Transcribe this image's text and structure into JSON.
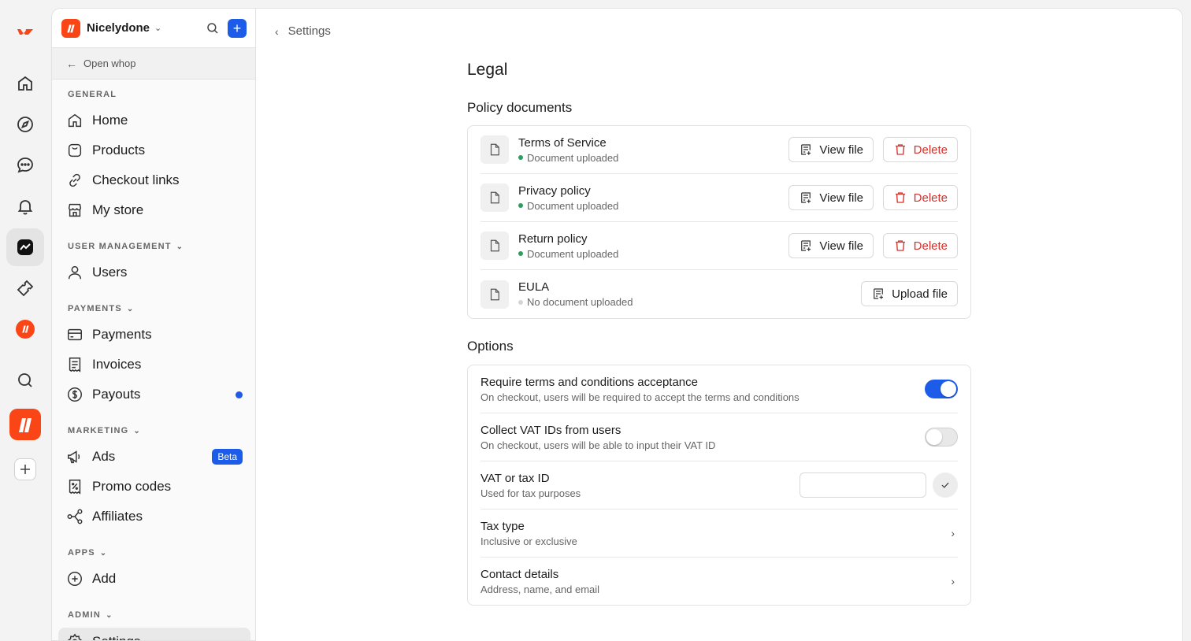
{
  "workspace": {
    "name": "Nicelydone",
    "back_label": "Open whop"
  },
  "sidebar": {
    "sections": [
      {
        "label": "GENERAL",
        "items": [
          "Home",
          "Products",
          "Checkout links",
          "My store"
        ]
      },
      {
        "label": "USER MANAGEMENT",
        "items": [
          "Users"
        ]
      },
      {
        "label": "PAYMENTS",
        "items": [
          "Payments",
          "Invoices",
          "Payouts"
        ]
      },
      {
        "label": "MARKETING",
        "items": [
          "Ads",
          "Promo codes",
          "Affiliates"
        ]
      },
      {
        "label": "APPS",
        "items": [
          "Add"
        ]
      },
      {
        "label": "ADMIN",
        "items": [
          "Settings"
        ]
      }
    ],
    "ads_badge": "Beta"
  },
  "breadcrumb": {
    "label": "Settings"
  },
  "page": {
    "title": "Legal",
    "policy_heading": "Policy documents",
    "options_heading": "Options"
  },
  "documents": [
    {
      "title": "Terms of Service",
      "status": "Document uploaded",
      "view_label": "View file",
      "delete_label": "Delete"
    },
    {
      "title": "Privacy policy",
      "status": "Document uploaded",
      "view_label": "View file",
      "delete_label": "Delete"
    },
    {
      "title": "Return policy",
      "status": "Document uploaded",
      "view_label": "View file",
      "delete_label": "Delete"
    },
    {
      "title": "EULA",
      "status": "No document uploaded",
      "upload_label": "Upload file"
    }
  ],
  "options": [
    {
      "title": "Require terms and conditions acceptance",
      "subtitle": "On checkout, users will be required to accept the terms and conditions",
      "toggle": true
    },
    {
      "title": "Collect VAT IDs from users",
      "subtitle": "On checkout, users will be able to input their VAT ID",
      "toggle": false
    },
    {
      "title": "VAT or tax ID",
      "subtitle": "Used for tax purposes",
      "input_value": ""
    },
    {
      "title": "Tax type",
      "subtitle": "Inclusive or exclusive"
    },
    {
      "title": "Contact details",
      "subtitle": "Address, name, and email"
    }
  ],
  "colors": {
    "accent": "#1d5ce8",
    "brand": "#fa4616",
    "danger": "#d6312b",
    "success": "#2e9e5f"
  }
}
